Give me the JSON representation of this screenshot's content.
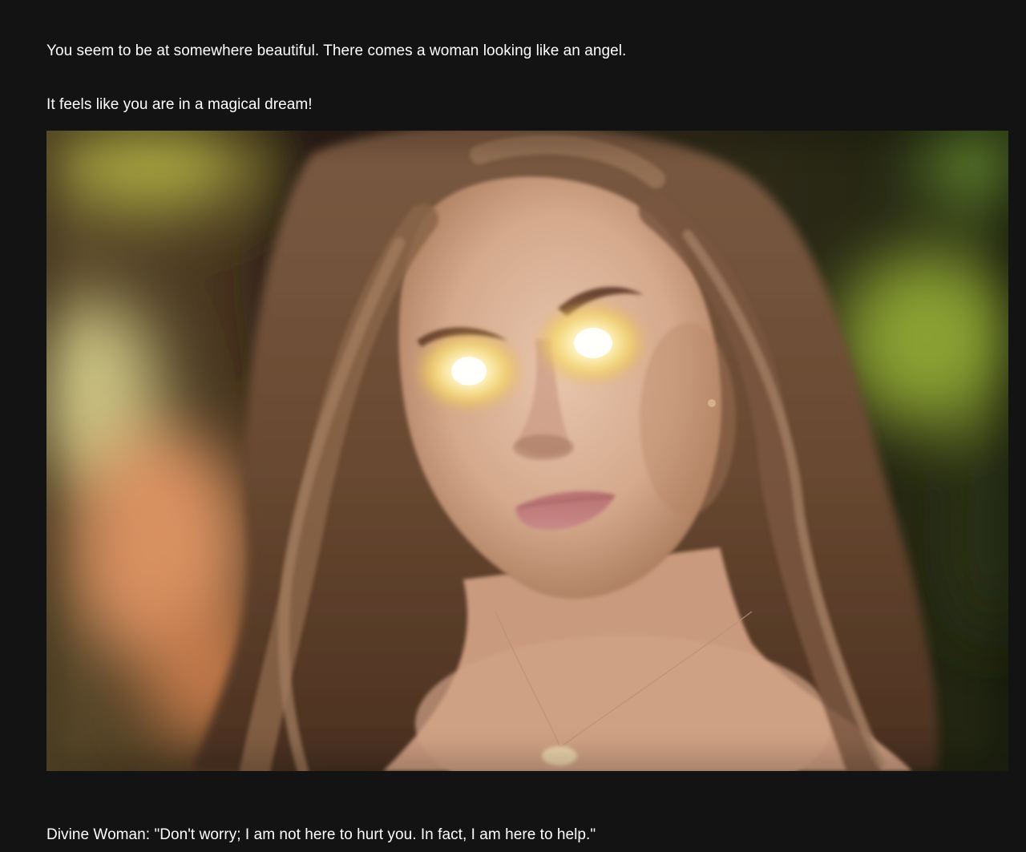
{
  "story": {
    "narration_1": "You seem to be at somewhere beautiful. There comes a woman looking like an angel.",
    "narration_2": "It feels like you are in a magical dream!",
    "dialogue": "Divine Woman: \"Don't worry; I am not here to hurt you. In fact, I am here to help.\""
  },
  "colors": {
    "page_background": "#131313",
    "text": "#ffffff",
    "eye_glow": "#fff6c8"
  }
}
